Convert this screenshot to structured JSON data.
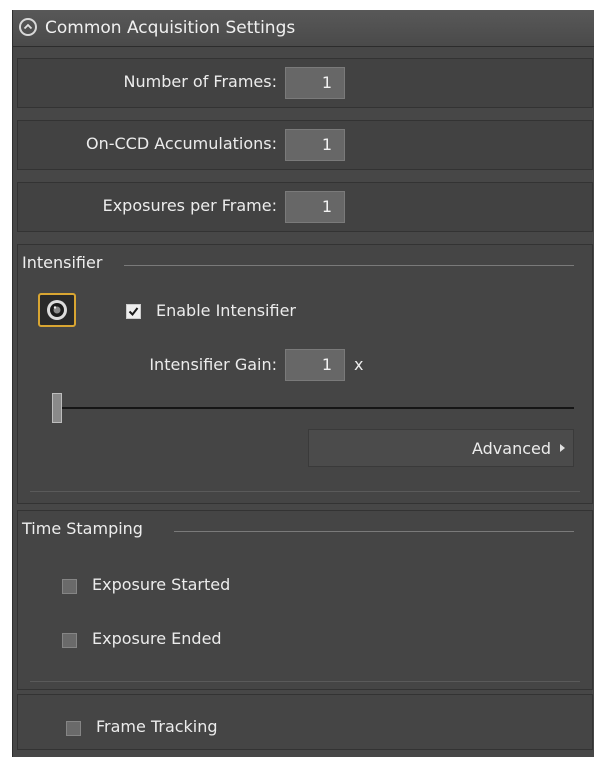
{
  "header": {
    "title": "Common Acquisition Settings"
  },
  "fields": [
    {
      "label": "Number of Frames:",
      "value": "1"
    },
    {
      "label": "On-CCD Accumulations:",
      "value": "1"
    },
    {
      "label": "Exposures per Frame:",
      "value": "1"
    }
  ],
  "intensifier": {
    "title": "Intensifier",
    "enable_label": "Enable Intensifier",
    "enabled": true,
    "gain_label": "Intensifier Gain:",
    "gain_value": "1",
    "gain_unit": "x",
    "slider_value_fraction": 0.0,
    "advanced_label": "Advanced"
  },
  "time_stamping": {
    "title": "Time Stamping",
    "items": [
      {
        "label": "Exposure Started",
        "checked": false
      },
      {
        "label": "Exposure Ended",
        "checked": false
      }
    ]
  },
  "frame_tracking": {
    "label": "Frame Tracking",
    "checked": false
  },
  "colors": {
    "accent": "#d8a532",
    "panel": "#474747"
  }
}
